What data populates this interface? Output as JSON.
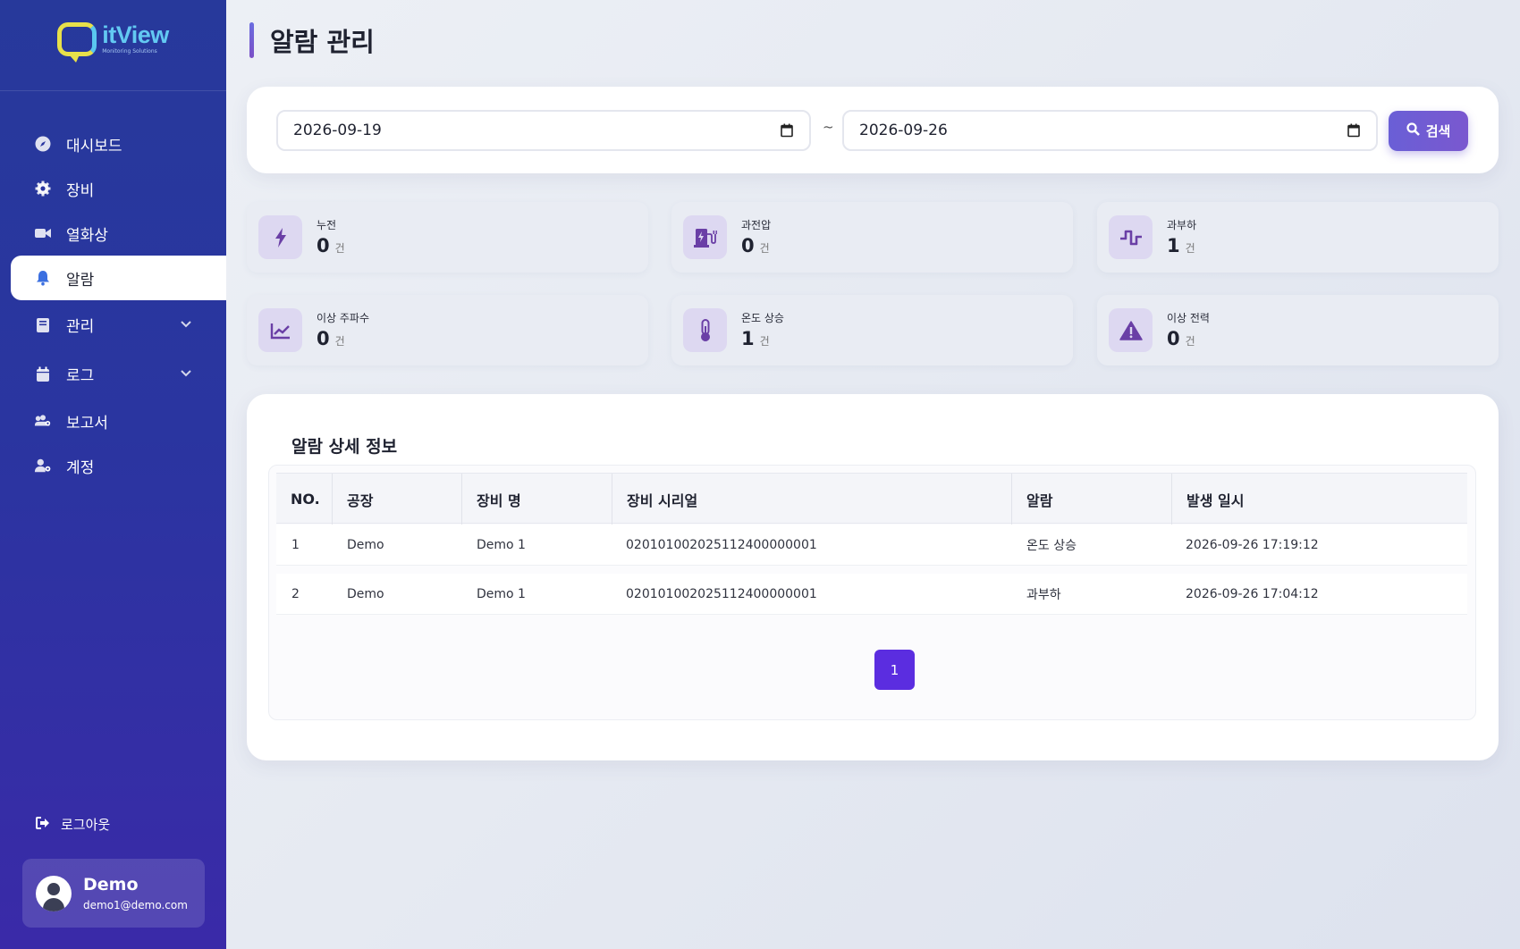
{
  "brand": {
    "name": "itView",
    "subtitle": "Monitoring Solutions"
  },
  "sidebar": {
    "items": [
      {
        "label": "대시보드",
        "icon": "compass-icon"
      },
      {
        "label": "장비",
        "icon": "gear-icon"
      },
      {
        "label": "열화상",
        "icon": "video-camera-icon"
      },
      {
        "label": "알람",
        "icon": "bell-icon",
        "active": true
      },
      {
        "label": "관리",
        "icon": "book-icon",
        "expandable": true
      },
      {
        "label": "로그",
        "icon": "calendar-icon",
        "expandable": true
      },
      {
        "label": "보고서",
        "icon": "users-cog-icon"
      },
      {
        "label": "계정",
        "icon": "user-cog-icon"
      }
    ],
    "logout_label": "로그아웃",
    "user": {
      "name": "Demo",
      "email": "demo1@demo.com"
    }
  },
  "page": {
    "title": "알람 관리"
  },
  "search": {
    "start_date": "2026-09-19",
    "separator": "~",
    "end_date": "2026-09-26",
    "button_label": "검색"
  },
  "stats": [
    {
      "label": "누전",
      "value": "0",
      "unit": "건",
      "icon": "lightning-icon"
    },
    {
      "label": "과전압",
      "value": "0",
      "unit": "건",
      "icon": "charging-station-icon"
    },
    {
      "label": "과부하",
      "value": "1",
      "unit": "건",
      "icon": "wave-square-icon"
    },
    {
      "label": "이상 주파수",
      "value": "0",
      "unit": "건",
      "icon": "chart-line-icon"
    },
    {
      "label": "온도 상승",
      "value": "1",
      "unit": "건",
      "icon": "thermometer-icon"
    },
    {
      "label": "이상 전력",
      "value": "0",
      "unit": "건",
      "icon": "warning-icon"
    }
  ],
  "detail": {
    "title": "알람 상세 정보",
    "columns": [
      "NO.",
      "공장",
      "장비 명",
      "장비 시리얼",
      "알람",
      "발생 일시"
    ],
    "rows": [
      [
        "1",
        "Demo",
        "Demo 1",
        "020101002025112400000001",
        "온도 상승",
        "2026-09-26 17:19:12"
      ],
      [
        "2",
        "Demo",
        "Demo 1",
        "020101002025112400000001",
        "과부하",
        "2026-09-26 17:04:12"
      ]
    ],
    "current_page": "1"
  },
  "colors": {
    "sidebar": "#2a35a0",
    "accent": "#5b2de0",
    "icon_purple": "#6a3fa6"
  }
}
